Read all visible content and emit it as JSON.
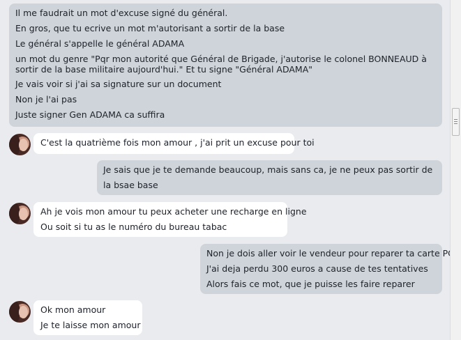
{
  "messages": [
    {
      "direction": "outgoing",
      "lines": [
        "Il me faudrait un mot d'excuse signé du général.",
        "En gros, que tu ecrive un mot m'autorisant a sortir de la base",
        "Le général s'appelle le général ADAMA",
        "un mot du genre \"Pqr mon autorité que Général de Brigade, j'autorise le colonel BONNEAUD à sortir de la base militaire aujourd'hui.\" Et tu signe \"Général ADAMA\"",
        "Je vais voir si j'ai sa signature sur un document",
        "Non je l'ai pas",
        "Juste signer Gen ADAMA ca suffira"
      ]
    },
    {
      "direction": "incoming",
      "lines": [
        "C'est la quatrième fois mon amour , j'ai prit un excuse pour toi"
      ]
    },
    {
      "direction": "outgoing",
      "lines": [
        "Je sais que je te demande beaucoup, mais sans ca, je ne peux pas sortir de la bsae base"
      ]
    },
    {
      "direction": "incoming",
      "lines": [
        "Ah je vois mon amour tu peux acheter une recharge en ligne",
        "Ou soit si tu as le numéro du bureau tabac"
      ]
    },
    {
      "direction": "outgoing",
      "lines": [
        "Non je dois aller voir le vendeur pour reparer ta carte PCS",
        "J'ai deja perdu 300 euros a cause de tes tentatives",
        "Alors fais ce mot, que je puisse les faire reparer"
      ]
    },
    {
      "direction": "incoming",
      "lines": [
        "Ok mon amour",
        "Je te laisse mon amour"
      ]
    }
  ]
}
